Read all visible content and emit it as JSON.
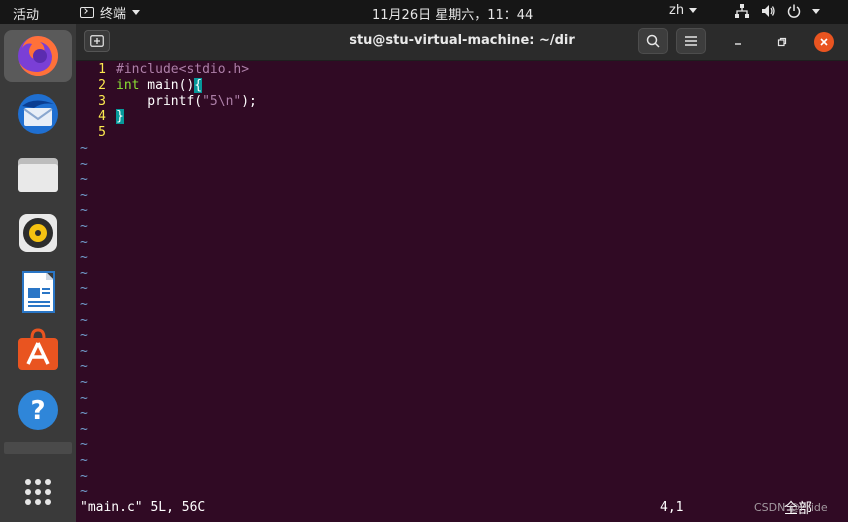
{
  "topbar": {
    "activities": "活动",
    "app_menu": "终端",
    "clock": "11月26日 星期六，11：44",
    "lang": "zh"
  },
  "dock": {
    "apps": [
      {
        "name": "firefox-icon",
        "label": "Firefox"
      },
      {
        "name": "thunderbird-icon",
        "label": "Thunderbird"
      },
      {
        "name": "files-icon",
        "label": "Files"
      },
      {
        "name": "rhythmbox-icon",
        "label": "Rhythmbox"
      },
      {
        "name": "writer-icon",
        "label": "LibreOffice Writer"
      },
      {
        "name": "software-icon",
        "label": "Ubuntu Software"
      },
      {
        "name": "help-icon",
        "label": "Help"
      }
    ]
  },
  "window": {
    "title": "stu@stu-virtual-machine: ~/dir"
  },
  "editor": {
    "lines": [
      {
        "num": "1",
        "text": "#include<stdio.h>"
      },
      {
        "num": "2",
        "text": "int main(){"
      },
      {
        "num": "3",
        "text": "    printf(\"5\\n\");"
      },
      {
        "num": "4",
        "text": "}"
      },
      {
        "num": "5",
        "text": ""
      }
    ],
    "tilde": "~",
    "status_file": "\"main.c\" 5L, 56C",
    "status_pos": "4,1",
    "status_all": "全部"
  },
  "watermark": "CSDN @Pride"
}
